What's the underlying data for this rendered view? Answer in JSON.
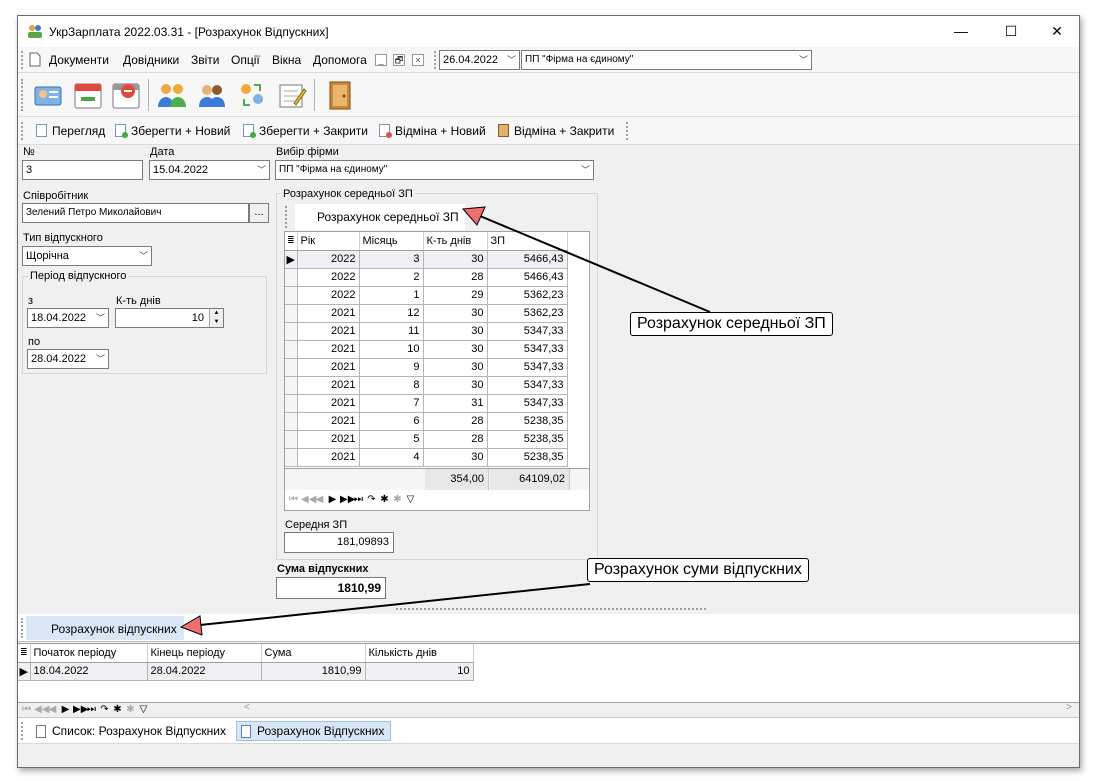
{
  "window": {
    "title": "УкрЗарплата 2022.03.31 - [Розрахунок Відпускних]",
    "controls": {
      "minimize": "—",
      "maximize": "☐",
      "close": "✕"
    }
  },
  "menu": {
    "items": [
      "Документи",
      "Довідники",
      "Звіти",
      "Опції",
      "Вікна",
      "Допомога"
    ],
    "mdi": [
      "_",
      "🗗",
      "×"
    ],
    "date_value": "26.04.2022",
    "firm_value": "ПП \"Фірма на єдиному\""
  },
  "toolbar": {
    "icons": [
      "employees-card-icon",
      "calendar-icon",
      "schedule-icon",
      "group-icon",
      "people-icon",
      "transfer-icon",
      "notepad-icon",
      "exit-door-icon"
    ]
  },
  "actions": {
    "view": "Перегляд",
    "save_new": "Зберегти + Новий",
    "save_close": "Зберегти + Закрити",
    "cancel_new": "Відміна + Новий",
    "cancel_close": "Відміна + Закрити"
  },
  "form": {
    "number_label": "№",
    "number_value": "3",
    "date_label": "Дата",
    "date_value": "15.04.2022",
    "firm_label": "Вибір фірми",
    "firm_value": "ПП \"Фірма на єдиному\"",
    "employee_label": "Співробітник",
    "employee_value": "Зелений Петро Миколайович",
    "employee_browse": "...",
    "vacation_type_label": "Тип відпускного",
    "vacation_type_value": "Щорічна",
    "period_group": "Період відпускного",
    "from_label": "з",
    "from_value": "18.04.2022",
    "days_label": "К-ть днів",
    "days_value": "10",
    "to_label": "по",
    "to_value": "28.04.2022"
  },
  "avg": {
    "group_label": "Розрахунок середньої ЗП",
    "tab_label": "Розрахунок середньої ЗП",
    "columns": [
      "Рік",
      "Місяць",
      "К-ть днів",
      "ЗП"
    ],
    "rows": [
      [
        "2022",
        "3",
        "30",
        "5466,43"
      ],
      [
        "2022",
        "2",
        "28",
        "5466,43"
      ],
      [
        "2022",
        "1",
        "29",
        "5362,23"
      ],
      [
        "2021",
        "12",
        "30",
        "5362,23"
      ],
      [
        "2021",
        "11",
        "30",
        "5347,33"
      ],
      [
        "2021",
        "10",
        "30",
        "5347,33"
      ],
      [
        "2021",
        "9",
        "30",
        "5347,33"
      ],
      [
        "2021",
        "8",
        "30",
        "5347,33"
      ],
      [
        "2021",
        "7",
        "31",
        "5347,33"
      ],
      [
        "2021",
        "6",
        "28",
        "5238,35"
      ],
      [
        "2021",
        "5",
        "28",
        "5238,35"
      ],
      [
        "2021",
        "4",
        "30",
        "5238,35"
      ]
    ],
    "total_days": "354,00",
    "total_salary": "64109,02",
    "avg_label": "Середня ЗП",
    "avg_value": "181,09893"
  },
  "sum": {
    "label": "Сума відпускних",
    "value": "1810,99"
  },
  "calc": {
    "tab_label": "Розрахунок відпускних",
    "columns": [
      "Початок періоду",
      "Кінець періоду",
      "Сума",
      "Кількість днів"
    ],
    "row": [
      "18.04.2022",
      "28.04.2022",
      "1810,99",
      "10"
    ]
  },
  "navigator": [
    "⏮",
    "◀◀",
    "◀",
    "▶",
    "▶▶",
    "⏭",
    "↷",
    "✱",
    "✱",
    "▽"
  ],
  "bottom_tabs": [
    "Список: Розрахунок Відпускних",
    "Розрахунок Відпускних"
  ],
  "callouts": {
    "avg": "Розрахунок середньої ЗП",
    "sum": "Розрахунок суми відпускних"
  },
  "colors": {
    "accent_tab": "#d9e6f5",
    "callout_arrow": "#f07070"
  }
}
